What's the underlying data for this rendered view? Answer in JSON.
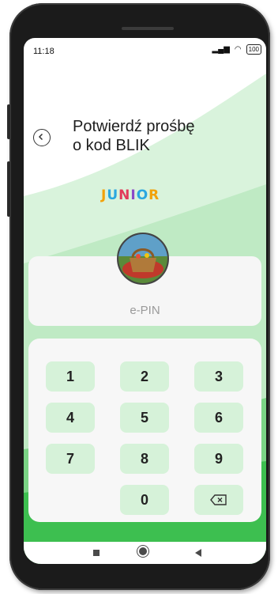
{
  "status": {
    "time": "11:18",
    "signal": "ᴿₗıl",
    "battery": "100"
  },
  "header": {
    "title_line1": "Potwierdź prośbę",
    "title_line2": "o kod BLIK"
  },
  "logo": {
    "letters": [
      {
        "ch": "J",
        "color": "#f2a20a"
      },
      {
        "ch": "U",
        "color": "#2aa7e0"
      },
      {
        "ch": "N",
        "color": "#e23a5a"
      },
      {
        "ch": "I",
        "color": "#8a49c8"
      },
      {
        "ch": "O",
        "color": "#2aa7e0"
      },
      {
        "ch": "R",
        "color": "#f2a20a"
      }
    ]
  },
  "pin": {
    "label": "e-PIN"
  },
  "keypad": {
    "keys": [
      "1",
      "2",
      "3",
      "4",
      "5",
      "6",
      "7",
      "8",
      "9",
      "0"
    ],
    "delete_icon": "backspace-icon"
  },
  "colors": {
    "accent_green": "#3dbf50",
    "key_bg": "#d6f2d9"
  }
}
